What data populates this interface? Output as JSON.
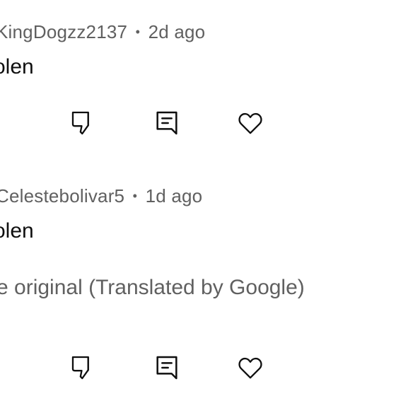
{
  "comments": [
    {
      "author": "KingDogzz2137",
      "separator": "•",
      "time": "2d ago",
      "text": "olen",
      "actions": [
        "dislike-icon",
        "reply-icon",
        "heart-icon"
      ]
    },
    {
      "author": "Celestebolivar5",
      "separator": "•",
      "time": "1d ago",
      "text": "olen",
      "translation_toggle": "e original (Translated by Google)",
      "actions": [
        "dislike-icon",
        "reply-icon",
        "heart-icon"
      ]
    }
  ],
  "colors": {
    "meta_text": "#606060",
    "body_text": "#0f0f0f",
    "icon_stroke": "#0f0f0f",
    "background": "#ffffff"
  }
}
